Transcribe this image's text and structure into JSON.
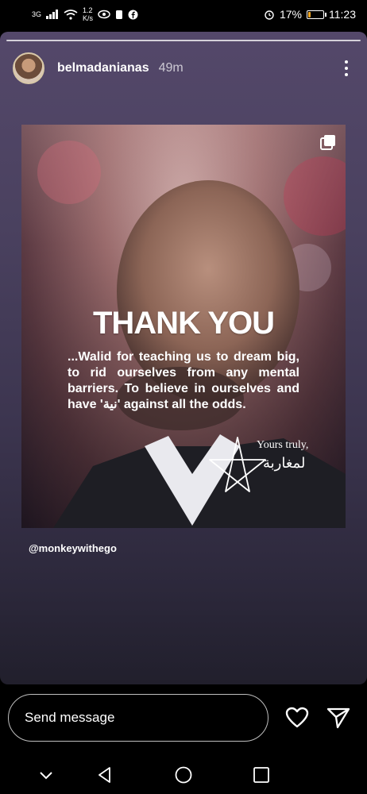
{
  "status_bar": {
    "network": "3G",
    "net_speed_value": "1.2",
    "net_speed_unit": "K/s",
    "battery": "17%",
    "time": "11:23",
    "battery_level": 0.17
  },
  "story": {
    "username": "belmadanianas",
    "time_ago": "49m"
  },
  "post": {
    "title": "THANK YOU",
    "body": "...Walid for teaching us to dream big, to rid ourselves from any mental barriers. To believe in ourselves and have 'نية' against all the odds.",
    "signature_en": "Yours truly,",
    "signature_ar": "لمغاربة",
    "mention": "@monkeywithego"
  },
  "reply": {
    "placeholder": "Send message"
  },
  "icons": {
    "more": "more-vertical-icon",
    "heart": "heart-icon",
    "send": "send-icon",
    "multi": "carousel-icon"
  }
}
